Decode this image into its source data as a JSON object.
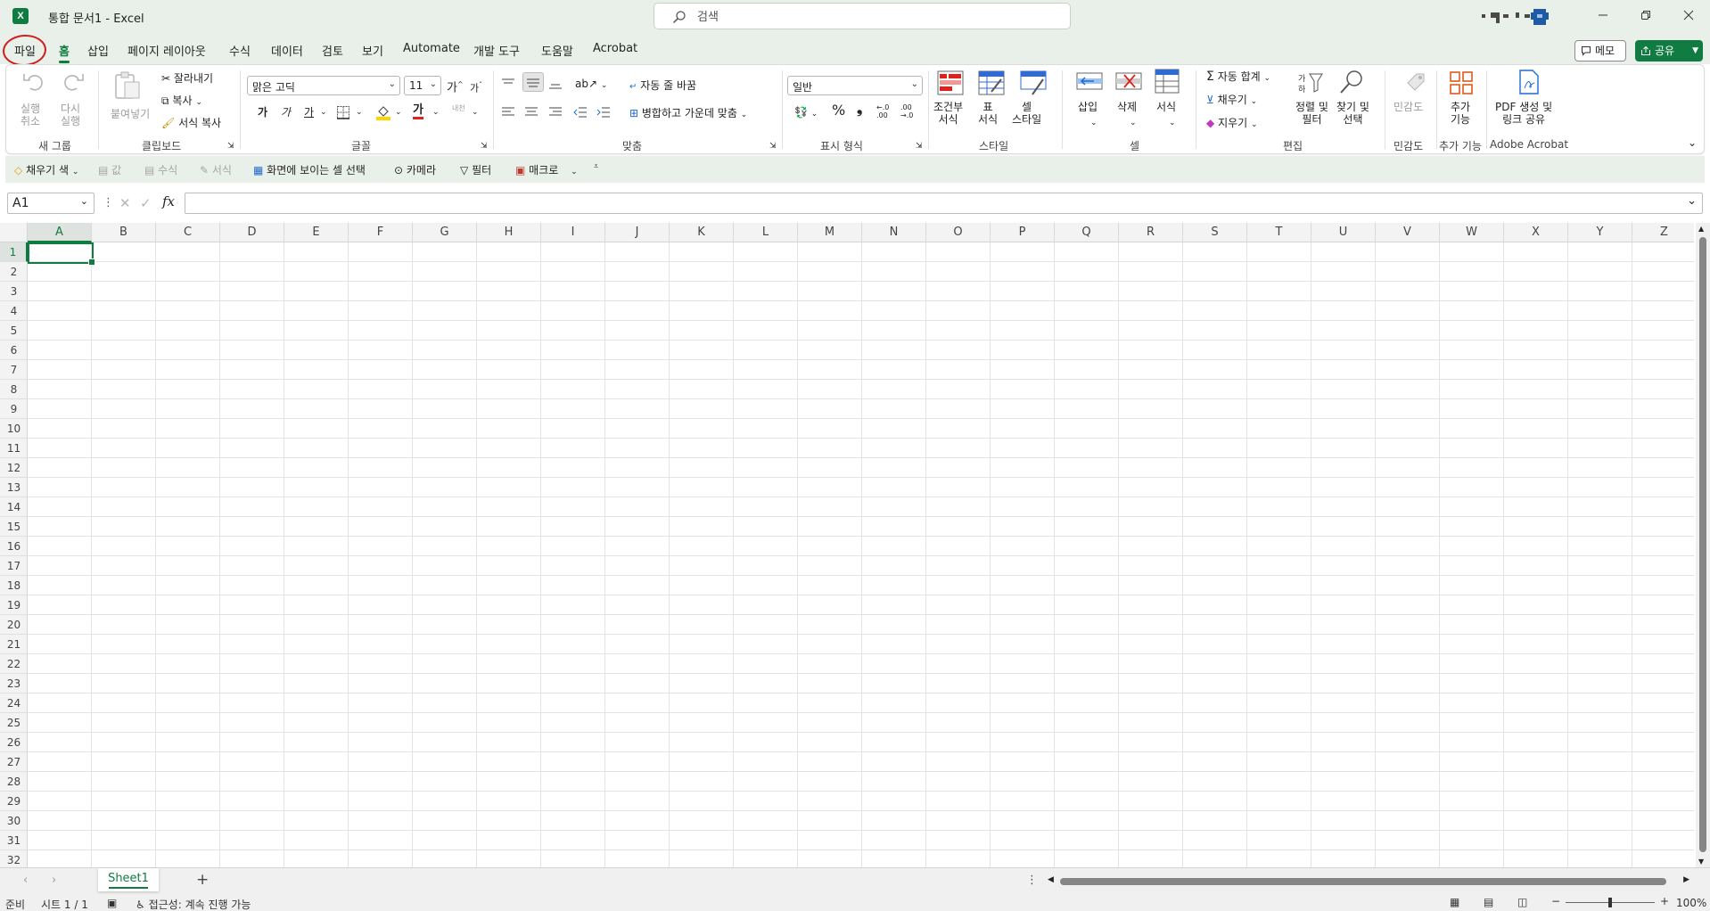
{
  "title_bar": {
    "app_icon_letter": "X",
    "document_title": "통합 문서1  -  Excel",
    "search_placeholder": "검색"
  },
  "menu": {
    "tabs": [
      {
        "label": "파일"
      },
      {
        "label": "홈"
      },
      {
        "label": "삽입"
      },
      {
        "label": "페이지 레이아웃"
      },
      {
        "label": "수식"
      },
      {
        "label": "데이터"
      },
      {
        "label": "검토"
      },
      {
        "label": "보기"
      },
      {
        "label": "Automate"
      },
      {
        "label": "개발 도구"
      },
      {
        "label": "도움말"
      },
      {
        "label": "Acrobat"
      }
    ],
    "active_tab": "홈",
    "memo_label": "메모",
    "share_label": "공유"
  },
  "ribbon": {
    "new_group": {
      "undo": "실행\n취소",
      "redo": "다시\n실행",
      "label": "새 그룹"
    },
    "clipboard": {
      "paste": "붙여넣기",
      "cut": "잘라내기",
      "copy": "복사",
      "format_painter": "서식 복사",
      "label": "클립보드"
    },
    "font": {
      "name": "맑은 고딕",
      "size": "11",
      "grow": "가",
      "shrink": "가",
      "bold": "가",
      "italic": "가",
      "underline": "가",
      "color_glyph": "가",
      "phonetic": "내천",
      "label": "글꼴"
    },
    "alignment": {
      "wrap_text": "자동 줄 바꿈",
      "merge_center": "병합하고 가운데 맞춤",
      "label": "맞춤"
    },
    "number": {
      "format": "일반",
      "percent": "%",
      "comma": "❟",
      "inc_decimal": "←.0\n.00",
      "dec_decimal": ".00\n→.0",
      "label": "표시 형식"
    },
    "styles": {
      "conditional": "조건부\n서식",
      "table": "표\n서식",
      "cell_styles": "셀\n스타일",
      "label": "스타일"
    },
    "cells": {
      "insert": "삽입",
      "delete": "삭제",
      "format": "서식",
      "label": "셀"
    },
    "editing": {
      "autosum": "자동 합계",
      "fill": "채우기",
      "clear": "지우기",
      "sort_filter": "정렬 및\n필터",
      "find_select": "찾기 및\n선택",
      "label": "편집"
    },
    "sensitivity": {
      "button": "민감도",
      "label": "민감도"
    },
    "addins": {
      "button": "추가\n기능",
      "label": "추가 기능"
    },
    "acrobat": {
      "button": "PDF 생성 및\n링크 공유",
      "label": "Adobe Acrobat"
    }
  },
  "quick_access": {
    "fill_color": "채우기 색",
    "values": "값",
    "formulas": "수식",
    "formats": "서식",
    "select_visible": "화면에 보이는 셀 선택",
    "camera": "카메라",
    "filter": "필터",
    "macro": "매크로"
  },
  "formula_bar": {
    "name_box": "A1",
    "fx": "fx",
    "content": ""
  },
  "grid": {
    "columns": [
      "A",
      "B",
      "C",
      "D",
      "E",
      "F",
      "G",
      "H",
      "I",
      "J",
      "K",
      "L",
      "M",
      "N",
      "O",
      "P",
      "Q",
      "R",
      "S",
      "T",
      "U",
      "V",
      "W",
      "X",
      "Y",
      "Z"
    ],
    "rows": [
      "1",
      "2",
      "3",
      "4",
      "5",
      "6",
      "7",
      "8",
      "9",
      "10",
      "11",
      "12",
      "13",
      "14",
      "15",
      "16",
      "17",
      "18",
      "19",
      "20",
      "21",
      "22",
      "23",
      "24",
      "25",
      "26",
      "27",
      "28",
      "29",
      "30",
      "31",
      "32"
    ],
    "active_column": "A",
    "active_row": "1"
  },
  "sheets": {
    "tabs": [
      {
        "label": "Sheet1"
      }
    ],
    "add": "+"
  },
  "status_bar": {
    "ready": "준비",
    "sheet_count": "시트 1 / 1",
    "accessibility": "접근성: 계속 진행 가능",
    "zoom": "100%"
  },
  "colors": {
    "accent": "#107c41",
    "chrome": "#e9f0ea",
    "annotation": "#d11e1e"
  }
}
